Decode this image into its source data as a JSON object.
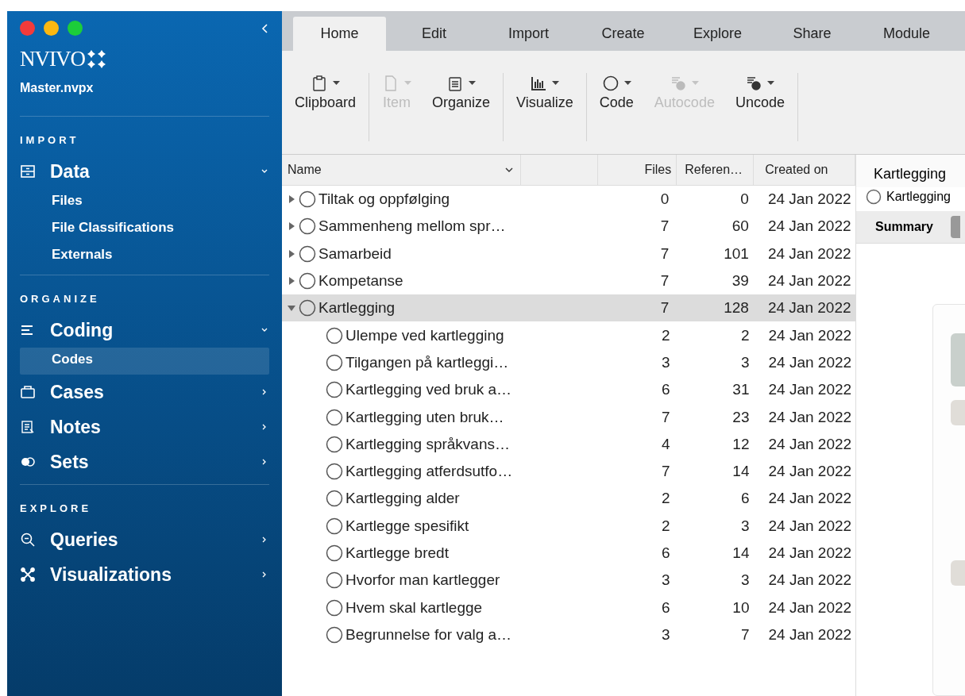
{
  "sidebar": {
    "logo": "NVIVO",
    "project": "Master.nvpx",
    "sections": [
      {
        "heading": "IMPORT",
        "items": [
          {
            "label": "Data",
            "expanded": true,
            "children": [
              {
                "label": "Files",
                "selected": false
              },
              {
                "label": "File Classifications",
                "selected": false
              },
              {
                "label": "Externals",
                "selected": false
              }
            ]
          }
        ]
      },
      {
        "heading": "ORGANIZE",
        "items": [
          {
            "label": "Coding",
            "expanded": true,
            "children": [
              {
                "label": "Codes",
                "selected": true
              }
            ]
          },
          {
            "label": "Cases",
            "expanded": false
          },
          {
            "label": "Notes",
            "expanded": false
          },
          {
            "label": "Sets",
            "expanded": false
          }
        ]
      },
      {
        "heading": "EXPLORE",
        "items": [
          {
            "label": "Queries",
            "expanded": false
          },
          {
            "label": "Visualizations",
            "expanded": false
          }
        ]
      }
    ]
  },
  "tabs": [
    {
      "label": "Home",
      "selected": true
    },
    {
      "label": "Edit",
      "selected": false
    },
    {
      "label": "Import",
      "selected": false
    },
    {
      "label": "Create",
      "selected": false
    },
    {
      "label": "Explore",
      "selected": false
    },
    {
      "label": "Share",
      "selected": false
    },
    {
      "label": "Module",
      "selected": false
    }
  ],
  "toolbar": [
    [
      {
        "label": "Clipboard",
        "disabled": false
      }
    ],
    [
      {
        "label": "Item",
        "disabled": true
      },
      {
        "label": "Organize",
        "disabled": false
      }
    ],
    [
      {
        "label": "Visualize",
        "disabled": false
      }
    ],
    [
      {
        "label": "Code",
        "disabled": false
      },
      {
        "label": "Autocode",
        "disabled": true
      },
      {
        "label": "Uncode",
        "disabled": false
      }
    ]
  ],
  "table": {
    "columns": [
      "Name",
      "Files",
      "Referen…",
      "Created on"
    ],
    "rows": [
      {
        "name": "Tiltak og oppfølging",
        "files": "0",
        "references": "0",
        "created": "24 Jan 2022",
        "expanded": false,
        "selected": false
      },
      {
        "name": "Sammenheng mellom spr…",
        "files": "7",
        "references": "60",
        "created": "24 Jan 2022",
        "expanded": false,
        "selected": false
      },
      {
        "name": "Samarbeid",
        "files": "7",
        "references": "101",
        "created": "24 Jan 2022",
        "expanded": false,
        "selected": false
      },
      {
        "name": "Kompetanse",
        "files": "7",
        "references": "39",
        "created": "24 Jan 2022",
        "expanded": false,
        "selected": false
      },
      {
        "name": "Kartlegging",
        "files": "7",
        "references": "128",
        "created": "24 Jan 2022",
        "expanded": true,
        "selected": true,
        "children": [
          {
            "name": "Ulempe ved kartlegging",
            "files": "2",
            "references": "2",
            "created": "24 Jan 2022",
            "selected": false
          },
          {
            "name": "Tilgangen på kartleggi…",
            "files": "3",
            "references": "3",
            "created": "24 Jan 2022",
            "selected": false
          },
          {
            "name": "Kartlegging ved bruk a…",
            "files": "6",
            "references": "31",
            "created": "24 Jan 2022",
            "selected": false
          },
          {
            "name": "Kartlegging uten bruk…",
            "files": "7",
            "references": "23",
            "created": "24 Jan 2022",
            "selected": false
          },
          {
            "name": "Kartlegging språkvans…",
            "files": "4",
            "references": "12",
            "created": "24 Jan 2022",
            "selected": false
          },
          {
            "name": "Kartlegging atferdsutfo…",
            "files": "7",
            "references": "14",
            "created": "24 Jan 2022",
            "selected": false
          },
          {
            "name": "Kartlegging alder",
            "files": "2",
            "references": "6",
            "created": "24 Jan 2022",
            "selected": false
          },
          {
            "name": "Kartlegge spesifikt",
            "files": "2",
            "references": "3",
            "created": "24 Jan 2022",
            "selected": false
          },
          {
            "name": "Kartlegge bredt",
            "files": "6",
            "references": "14",
            "created": "24 Jan 2022",
            "selected": false
          },
          {
            "name": "Hvorfor man kartlegger",
            "files": "3",
            "references": "3",
            "created": "24 Jan 2022",
            "selected": false
          },
          {
            "name": "Hvem skal kartlegge",
            "files": "6",
            "references": "10",
            "created": "24 Jan 2022",
            "selected": false
          },
          {
            "name": "Begrunnelse for valg a…",
            "files": "3",
            "references": "7",
            "created": "24 Jan 2022",
            "selected": false
          }
        ]
      }
    ]
  },
  "detail": {
    "tab": "Kartlegging",
    "code": "Kartlegging",
    "view_tab": "Summary"
  }
}
